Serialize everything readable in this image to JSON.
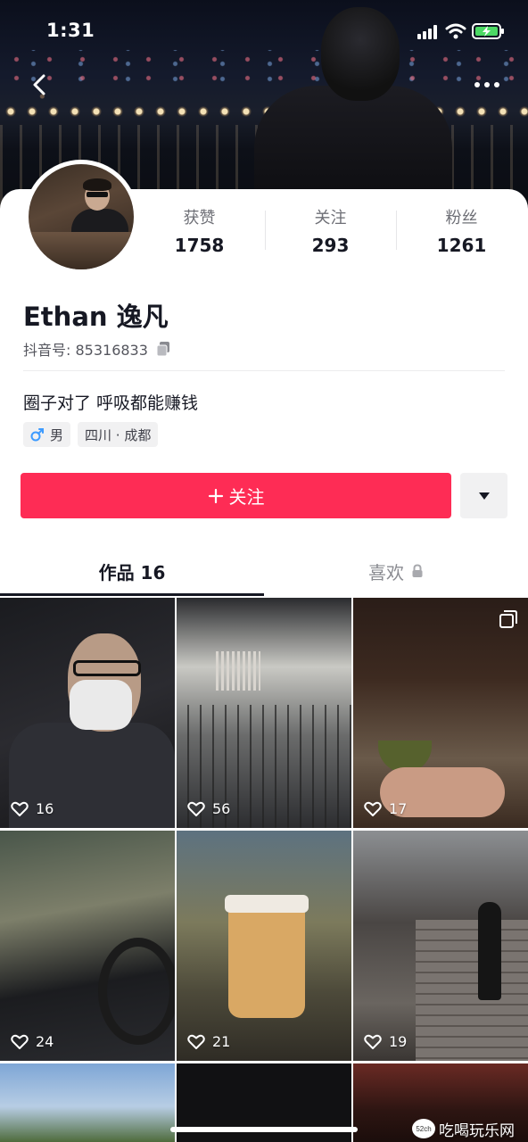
{
  "status_bar": {
    "time": "1:31"
  },
  "profile": {
    "name": "Ethan 逸凡",
    "douyin_id": "抖音号: 85316833",
    "bio": "圈子对了 呼吸都能赚钱",
    "gender_tag": "男",
    "location_tag": "四川 · 成都"
  },
  "stats": [
    {
      "label": "获赞",
      "value": "1758"
    },
    {
      "label": "关注",
      "value": "293"
    },
    {
      "label": "粉丝",
      "value": "1261"
    }
  ],
  "actions": {
    "follow_label": "关注"
  },
  "tabs": [
    {
      "label": "作品 16",
      "active": true
    },
    {
      "label": "喜欢",
      "locked": true
    }
  ],
  "videos": [
    {
      "likes": "16"
    },
    {
      "likes": "56"
    },
    {
      "likes": "17",
      "multi_image": true
    },
    {
      "likes": "24"
    },
    {
      "likes": "21"
    },
    {
      "likes": "19"
    }
  ],
  "watermark": {
    "badge": "52ch",
    "text": "吃喝玩乐网"
  },
  "colors": {
    "accent": "#fe2c55",
    "text": "#161823",
    "muted": "#6e6f76"
  }
}
